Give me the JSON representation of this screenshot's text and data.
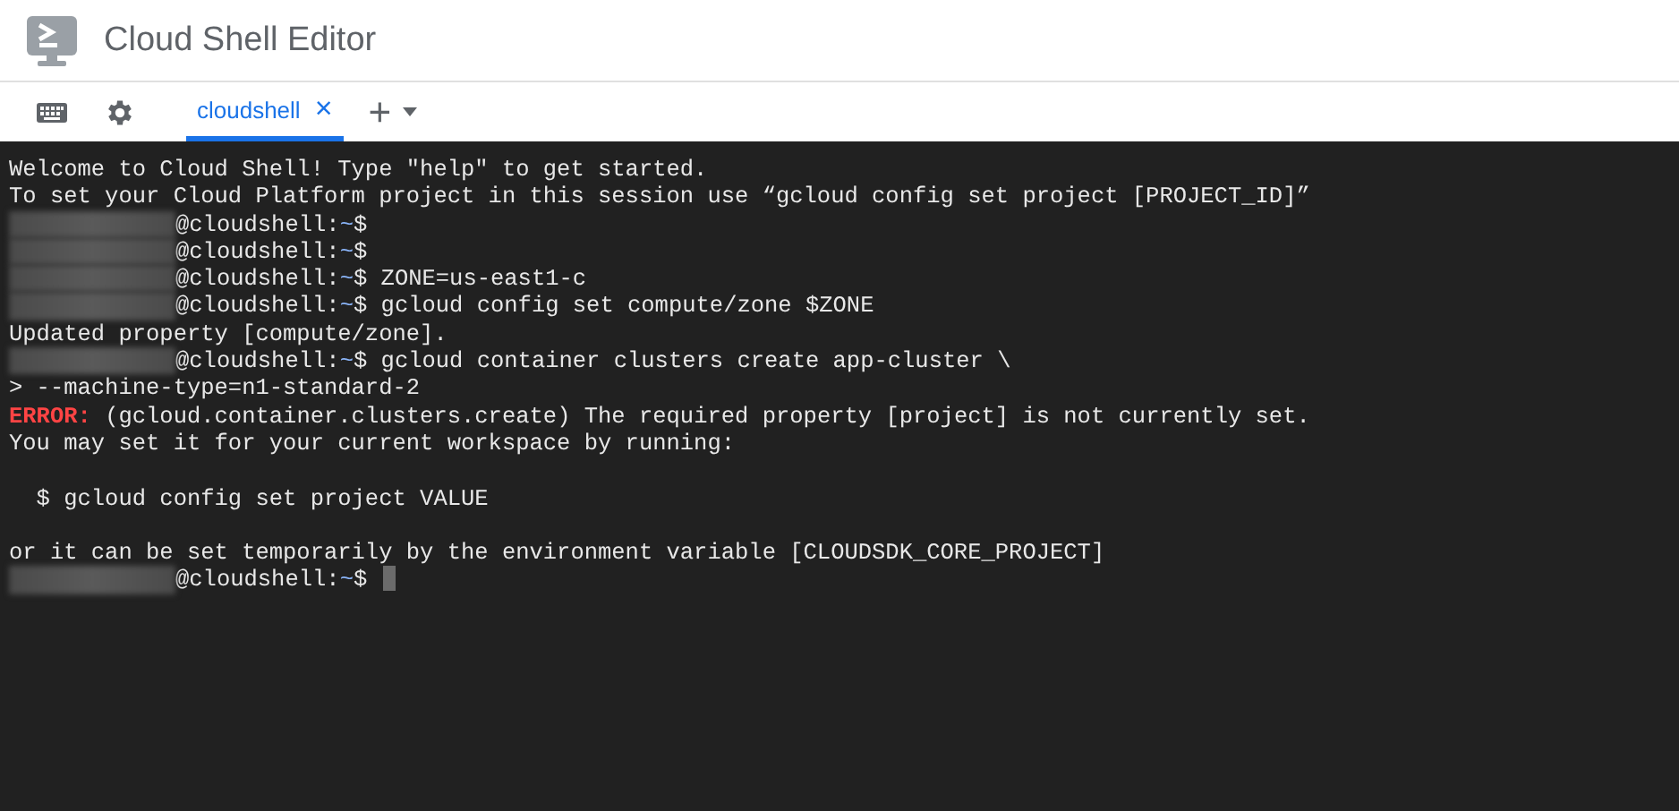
{
  "window": {
    "title": "Cloud Shell Editor"
  },
  "tabs": [
    {
      "label": "cloudshell",
      "selected": true,
      "close": "×"
    }
  ],
  "add_tab": "+",
  "terminal": {
    "lines": [
      {
        "kind": "text",
        "text": "Welcome to Cloud Shell! Type \"help\" to get started."
      },
      {
        "kind": "text",
        "text": "To set your Cloud Platform project in this session use “gcloud config set project [PROJECT_ID]”"
      },
      {
        "kind": "prompt",
        "host": "@cloudshell:",
        "path": "~",
        "command": "$"
      },
      {
        "kind": "prompt",
        "host": "@cloudshell:",
        "path": "~",
        "command": "$"
      },
      {
        "kind": "prompt",
        "host": "@cloudshell:",
        "path": "~",
        "command": "$ ZONE=us-east1-c"
      },
      {
        "kind": "prompt",
        "host": "@cloudshell:",
        "path": "~",
        "command": "$ gcloud config set compute/zone $ZONE"
      },
      {
        "kind": "text",
        "text": "Updated property [compute/zone]."
      },
      {
        "kind": "prompt",
        "host": "@cloudshell:",
        "path": "~",
        "command": "$ gcloud container clusters create app-cluster \\"
      },
      {
        "kind": "text",
        "text": "> --machine-type=n1-standard-2"
      },
      {
        "kind": "error",
        "label": "ERROR:",
        "text": " (gcloud.container.clusters.create) The required property [project] is not currently set."
      },
      {
        "kind": "text",
        "text": "You may set it for your current workspace by running:"
      },
      {
        "kind": "blank"
      },
      {
        "kind": "text",
        "text": "  $ gcloud config set project VALUE"
      },
      {
        "kind": "blank"
      },
      {
        "kind": "text",
        "text": "or it can be set temporarily by the environment variable [CLOUDSDK_CORE_PROJECT]"
      },
      {
        "kind": "prompt",
        "host": "@cloudshell:",
        "path": "~",
        "command": "$ ",
        "cursor": true
      }
    ]
  }
}
